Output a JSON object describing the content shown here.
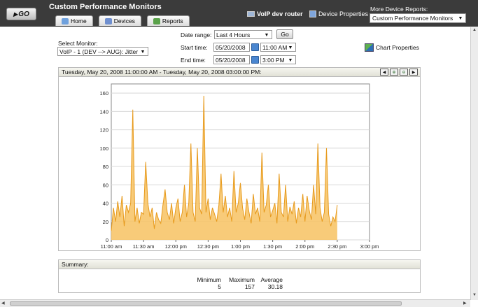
{
  "header": {
    "go_label": "GO",
    "title": "Custom Performance Monitors",
    "tabs": [
      {
        "label": "Home",
        "icon": "home-icon"
      },
      {
        "label": "Devices",
        "icon": "devices-icon"
      },
      {
        "label": "Reports",
        "icon": "reports-icon"
      }
    ],
    "device_name": "VoIP dev router",
    "device_properties": "Device Properties",
    "more_reports_label": "More Device Reports:",
    "more_reports_value": "Custom Performance Monitors"
  },
  "controls": {
    "select_monitor_label": "Select Monitor:",
    "select_monitor_value": "VoIP - 1 (DEV --> AUG): Jitter",
    "date_range_label": "Date range:",
    "date_range_value": "Last 4 Hours",
    "go_label": "Go",
    "start_label": "Start time:",
    "start_date": "05/20/2008",
    "start_time": "11:00 AM",
    "end_label": "End time:",
    "end_date": "05/20/2008",
    "end_time": "3:00 PM",
    "chart_properties": "Chart Properties"
  },
  "chart_panel": {
    "range_text": "Tuesday, May 20, 2008 11:00:00 AM - Tuesday, May 20, 2008 03:00:00 PM:"
  },
  "summary": {
    "header": "Summary:",
    "min_label": "Minimum",
    "min_value": "5",
    "max_label": "Maximum",
    "max_value": "157",
    "avg_label": "Average",
    "avg_value": "30.18"
  },
  "chart_data": {
    "type": "area",
    "title": "",
    "xlabel": "",
    "ylabel": "",
    "ylim": [
      0,
      170
    ],
    "yticks": [
      0,
      20,
      40,
      60,
      80,
      100,
      120,
      140,
      160
    ],
    "xticks": [
      "11:00 am",
      "11:30 am",
      "12:00 pm",
      "12:30 pm",
      "1:00 pm",
      "1:30 pm",
      "2:00 pm",
      "2:30 pm",
      "3:00 pm"
    ],
    "grid": true,
    "colors": {
      "fill": "#f7c56a",
      "line": "#e79a1c"
    },
    "x_minutes": [
      0,
      2,
      4,
      6,
      8,
      10,
      12,
      14,
      16,
      18,
      20,
      22,
      24,
      26,
      28,
      30,
      32,
      34,
      36,
      38,
      40,
      42,
      44,
      46,
      48,
      50,
      52,
      54,
      56,
      58,
      60,
      62,
      64,
      66,
      68,
      70,
      72,
      74,
      76,
      78,
      80,
      82,
      84,
      86,
      88,
      90,
      92,
      94,
      96,
      98,
      100,
      102,
      104,
      106,
      108,
      110,
      112,
      114,
      116,
      118,
      120,
      122,
      124,
      126,
      128,
      130,
      132,
      134,
      136,
      138,
      140,
      142,
      144,
      146,
      148,
      150,
      152,
      154,
      156,
      158,
      160,
      162,
      164,
      166,
      168,
      170,
      172,
      174,
      176,
      178,
      180,
      182,
      184,
      186,
      188,
      190,
      192,
      194,
      196,
      198,
      200,
      202,
      204,
      206,
      208,
      210
    ],
    "values": [
      10,
      35,
      20,
      42,
      25,
      48,
      15,
      38,
      30,
      40,
      142,
      20,
      35,
      18,
      30,
      28,
      85,
      40,
      25,
      35,
      12,
      30,
      22,
      18,
      38,
      55,
      30,
      22,
      40,
      18,
      35,
      45,
      20,
      30,
      60,
      25,
      40,
      105,
      30,
      20,
      100,
      35,
      28,
      157,
      30,
      45,
      22,
      35,
      28,
      20,
      38,
      72,
      30,
      48,
      25,
      35,
      20,
      75,
      30,
      40,
      62,
      35,
      22,
      45,
      30,
      18,
      50,
      28,
      35,
      20,
      95,
      30,
      38,
      60,
      25,
      32,
      40,
      18,
      72,
      30,
      25,
      60,
      20,
      36,
      28,
      42,
      18,
      35,
      25,
      50,
      20,
      48,
      32,
      22,
      60,
      28,
      105,
      35,
      20,
      30,
      100,
      28,
      15,
      25,
      20,
      38
    ]
  }
}
